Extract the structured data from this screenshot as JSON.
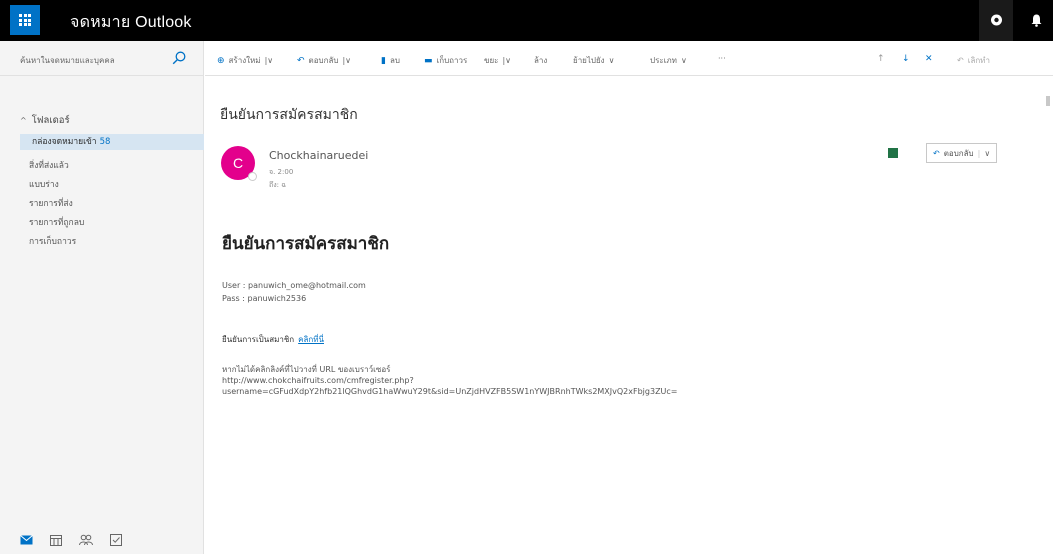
{
  "header": {
    "app_title": "จดหมาย Outlook"
  },
  "search": {
    "placeholder": "ค้นหาในจดหมายและบุคคล"
  },
  "toolbar": {
    "new": "สร้างใหม่",
    "reply_all": "ตอบกลับ",
    "delete": "ลบ",
    "archive": "เก็บถาวร",
    "junk": "ขยะ",
    "sweep": "ล้าง",
    "move_to": "ย้ายไปยัง",
    "categories": "ประเภท",
    "more": "···",
    "undo": "เลิกทำ"
  },
  "folders": {
    "heading": "โฟลเดอร์",
    "inbox": "กล่องจดหมายเข้า",
    "inbox_count": "58",
    "items": [
      "สิ่งที่ส่งแล้ว",
      "แบบร่าง",
      "รายการที่ส่ง",
      "รายการที่ถูกลบ",
      "การเก็บถาวร"
    ]
  },
  "message": {
    "subject": "ยืนยันการสมัครสมาชิก",
    "avatar_letter": "C",
    "sender": "Chockhainaruedei",
    "sent_time": "จ. 2:00",
    "to": "ถึง: ฉ",
    "reply_label": "ตอบกลับ",
    "body_title": "ยืนยันการสมัครสมาชิก",
    "user_line": "User : panuwich_ome@hotmail.com",
    "pass_line": "Pass : panuwich2536",
    "confirm_label": "ยืนยันการเป็นสมาชิก",
    "confirm_link": "คลิกที่นี่",
    "note_line": "หากไม่ได้คลิกลิงค์ที่ไปวางที่ URL ของเบราว์เซอร์",
    "url_line1": "http://www.chokchaifruits.com/cmfregister.php?",
    "url_line2": "username=cGFudXdpY2hfb21lQGhvdG1haWwuY29t&sid=UnZjdHVZFB5SW1nYWJBRnhTWks2MXJvQ2xFbjg3ZUc="
  },
  "colors": {
    "brand_blue": "#0072c6",
    "avatar_pink": "#e3008c",
    "header_black": "#000000"
  }
}
